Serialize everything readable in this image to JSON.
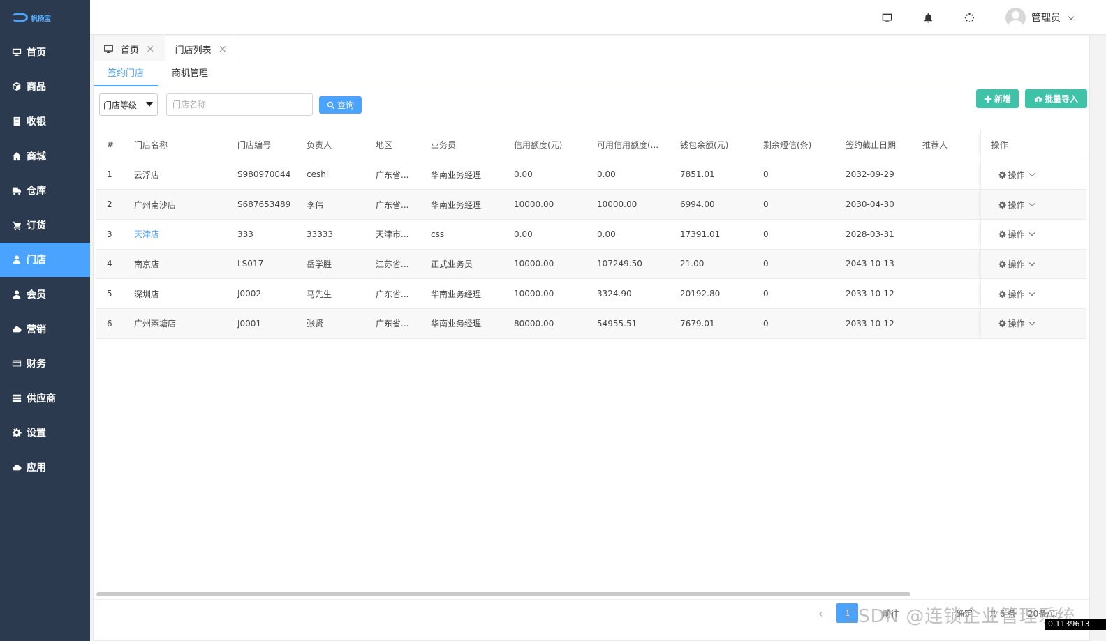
{
  "app": {
    "logo_text": "帆扬宝"
  },
  "sidebar": {
    "items": [
      {
        "label": "首页",
        "icon": "monitor-icon"
      },
      {
        "label": "商品",
        "icon": "cube-icon"
      },
      {
        "label": "收银",
        "icon": "receipt-icon"
      },
      {
        "label": "商城",
        "icon": "home-icon"
      },
      {
        "label": "仓库",
        "icon": "truck-icon"
      },
      {
        "label": "订货",
        "icon": "cart-icon"
      },
      {
        "label": "门店",
        "icon": "user-icon"
      },
      {
        "label": "会员",
        "icon": "user-icon"
      },
      {
        "label": "营销",
        "icon": "cloud-icon"
      },
      {
        "label": "财务",
        "icon": "card-icon"
      },
      {
        "label": "供应商",
        "icon": "server-icon"
      },
      {
        "label": "设置",
        "icon": "gear-icon"
      },
      {
        "label": "应用",
        "icon": "cloud-icon"
      }
    ],
    "active": "门店",
    "active_color": "#4aa3ff",
    "background": "#2b3a4e"
  },
  "header": {
    "user_name": "管理员"
  },
  "page_tabs": [
    {
      "label": "首页"
    },
    {
      "label": "门店列表"
    }
  ],
  "sub_tabs": [
    {
      "label": "签约门店"
    },
    {
      "label": "商机管理"
    }
  ],
  "filters": {
    "level_select": "门店等级",
    "name_placeholder": "门店名称",
    "query_label": "查询",
    "add_label": "新增",
    "import_label": "批量导入"
  },
  "table": {
    "headers": [
      "#",
      "门店名称",
      "门店编号",
      "负责人",
      "地区",
      "业务员",
      "信用额度(元)",
      "可用信用额度(...",
      "钱包余额(元)",
      "剩余短信(条)",
      "签约截止日期",
      "推荐人",
      "操作"
    ],
    "rows": [
      [
        "1",
        "云浮店",
        "S980970044",
        "ceshi",
        "广东省...",
        "华南业务经理",
        "0.00",
        "0.00",
        "7851.01",
        "0",
        "2032-09-29",
        "",
        "操作"
      ],
      [
        "2",
        "广州南沙店",
        "S687653489",
        "李伟",
        "广东省...",
        "华南业务经理",
        "10000.00",
        "10000.00",
        "6994.00",
        "0",
        "2030-04-30",
        "",
        "操作"
      ],
      [
        "3",
        "天津店",
        "333",
        "33333",
        "天津市...",
        "css",
        "0.00",
        "0.00",
        "17391.01",
        "0",
        "2028-03-31",
        "",
        "操作"
      ],
      [
        "4",
        "南京店",
        "LS017",
        "岳学胜",
        "江苏省...",
        "正式业务员",
        "10000.00",
        "107249.50",
        "21.00",
        "0",
        "2043-10-13",
        "",
        "操作"
      ],
      [
        "5",
        "深圳店",
        "J0002",
        "马先生",
        "广东省...",
        "华南业务经理",
        "10000.00",
        "3324.90",
        "20192.80",
        "0",
        "2033-10-12",
        "",
        "操作"
      ],
      [
        "6",
        "广州燕塘店",
        "J0001",
        "张贤",
        "广东省...",
        "华南业务经理",
        "80000.00",
        "54955.51",
        "7679.01",
        "0",
        "2033-10-12",
        "",
        "操作"
      ]
    ]
  },
  "pager": {
    "current": "1",
    "goto": "前往",
    "confirm": "确定",
    "total": "共 6 条",
    "page_size": "20条/页"
  },
  "overlay": {
    "watermark": "CSDN @连锁企业管理系统",
    "fps": "0.1139613"
  }
}
